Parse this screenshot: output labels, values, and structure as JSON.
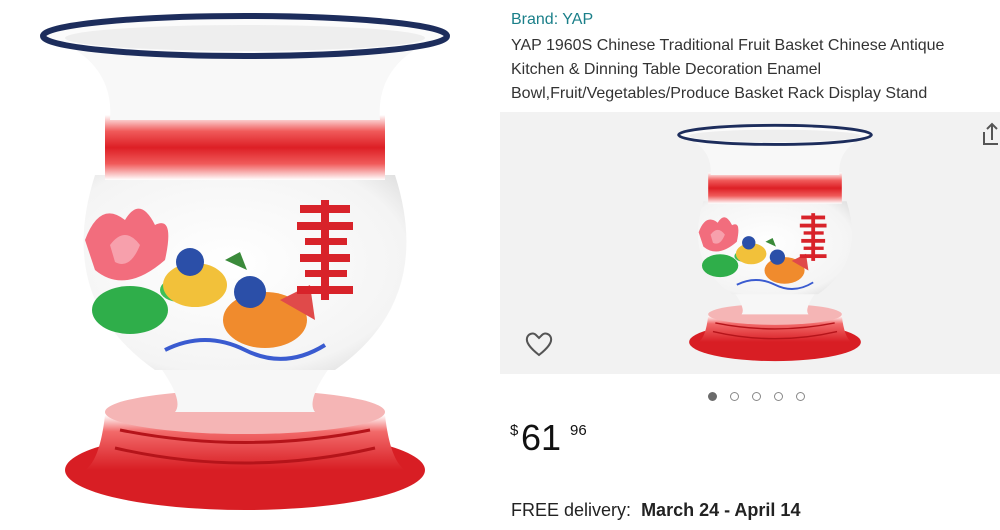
{
  "brand_line": "Brand: YAP",
  "product_title": "YAP 1960S Chinese Traditional Fruit Basket Chinese Antique Kitchen & Dinning Table Decoration Enamel Bowl,Fruit/Vegetables/Produce Basket Rack Display Stand",
  "gallery": {
    "active_index": 1,
    "count": 5
  },
  "price": {
    "symbol": "$",
    "whole": "61",
    "fraction": "96"
  },
  "delivery": {
    "label": "FREE delivery:",
    "dates": "March 24 - April 14"
  },
  "icons": {
    "favorite": "heart-outline-icon",
    "share": "share-icon"
  },
  "colors": {
    "enamel_red": "#e0262b",
    "rim_navy": "#1d2d5c",
    "brand_link": "#1a7f89"
  }
}
